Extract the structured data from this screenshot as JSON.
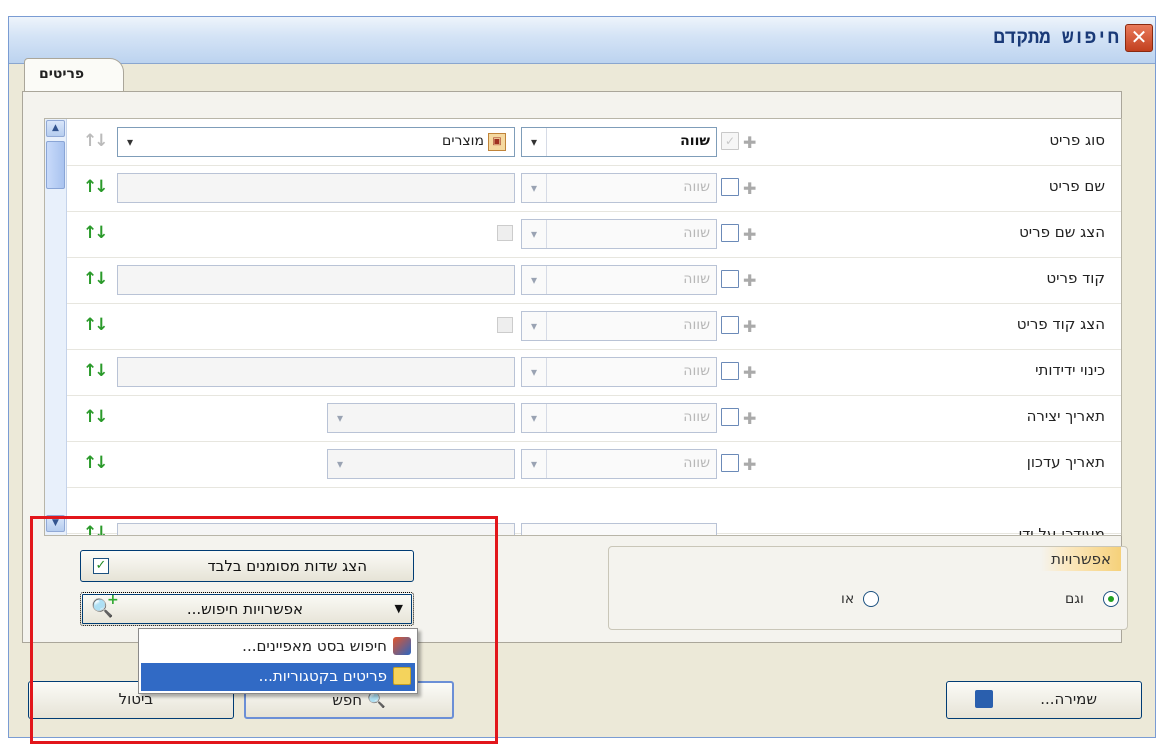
{
  "window": {
    "title": "חיפוש מתקדם",
    "close_glyph": "✕"
  },
  "tabs": [
    {
      "label": "פריטים",
      "active": true
    }
  ],
  "grid": {
    "rows": [
      {
        "label": "סוג פריט",
        "compare": "שווה",
        "checked": true,
        "value": "מוצרים",
        "type": "select-active"
      },
      {
        "label": "שם פריט",
        "compare": "שווה",
        "checked": false,
        "type": "text"
      },
      {
        "label": "הצג שם פריט",
        "compare": "שווה",
        "checked": false,
        "type": "bool"
      },
      {
        "label": "קוד פריט",
        "compare": "שווה",
        "checked": false,
        "type": "text"
      },
      {
        "label": "הצג קוד פריט",
        "compare": "שווה",
        "checked": false,
        "type": "bool"
      },
      {
        "label": "כינוי ידידותי",
        "compare": "שווה",
        "checked": false,
        "type": "text"
      },
      {
        "label": "תאריך יצירה",
        "compare": "שווה",
        "checked": false,
        "type": "date"
      },
      {
        "label": "תאריך עדכון",
        "compare": "שווה",
        "checked": false,
        "type": "date"
      }
    ],
    "partial_row_label": "מעודכן על ידי"
  },
  "show_marked_only": {
    "label": "הצג שדות מסומנים בלבד",
    "checked": true
  },
  "search_options": {
    "label": "אפשרויות חיפוש..."
  },
  "popup_menu": {
    "items": [
      {
        "label": "חיפוש בסט מאפיינים...",
        "icon": "cube-icon"
      },
      {
        "label": "פריטים בקטגוריות...",
        "icon": "folder-icon",
        "highlighted": true
      }
    ]
  },
  "options": {
    "title": "אפשרויות",
    "and_label": "וגם",
    "or_label": "או",
    "selected": "and"
  },
  "buttons": {
    "save": "שמירה...",
    "search": "חפש",
    "cancel": "ביטול"
  },
  "colors": {
    "highlight_border": "#e2161b",
    "selection": "#316ac5",
    "sort_icon": "#2a9a2a"
  }
}
